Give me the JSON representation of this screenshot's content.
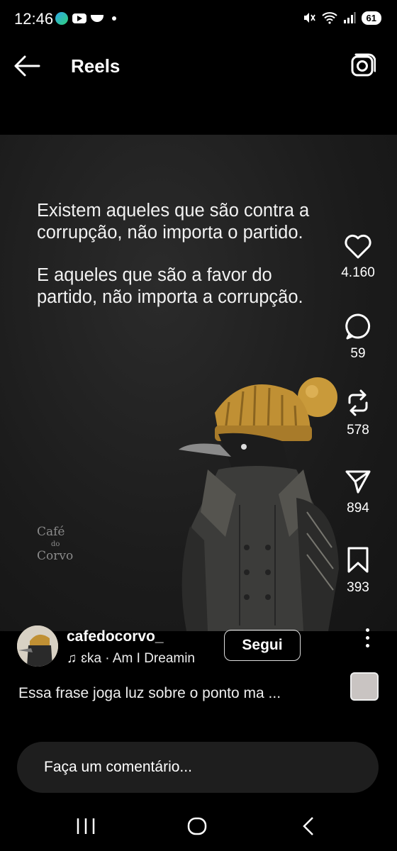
{
  "status_bar": {
    "time": "12:46",
    "battery": "61",
    "icons": [
      "edge-icon",
      "youtube-icon",
      "app-icon",
      "dot",
      "mute-icon",
      "wifi-icon",
      "signal-icon"
    ]
  },
  "header": {
    "title": "Reels"
  },
  "reel": {
    "quote_line1": "Existem aqueles que são contra a corrupção, não importa o partido.",
    "quote_line2": "E aqueles que são a favor do partido, não importa a corrupção.",
    "brand_top": "Café",
    "brand_mid": "do",
    "brand_bottom": "Corvo"
  },
  "actions": {
    "likes": "4.160",
    "comments": "59",
    "reposts": "578",
    "shares": "894",
    "saves": "393"
  },
  "author": {
    "username": "cafedocorvo_",
    "music": "ɛka · Am I Dreamin",
    "follow_label": "Segui"
  },
  "caption": "Essa frase joga luz sobre o ponto ma ...",
  "comment_box": {
    "placeholder": "Faça um comentário..."
  },
  "colors": {
    "background": "#000000",
    "video_bg": "#1b1b1b",
    "comment_bg": "#1e1e1e"
  }
}
